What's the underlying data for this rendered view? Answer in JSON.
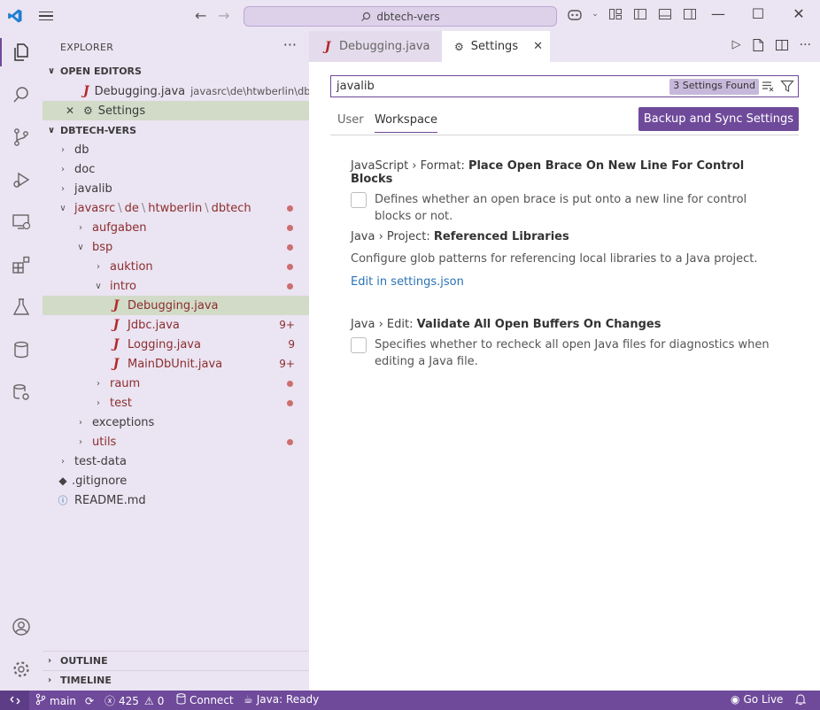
{
  "titlebar": {
    "search_text": "dbtech-vers"
  },
  "activity": {
    "items": [
      "explorer-icon",
      "search-icon",
      "source-control-icon",
      "run-debug-icon",
      "remote-explorer-icon",
      "extensions-icon",
      "testing-icon",
      "database-icon",
      "database-settings-icon",
      "account-icon",
      "manage-gear-icon"
    ]
  },
  "sidebar": {
    "title": "EXPLORER",
    "open_editors": {
      "header": "OPEN EDITORS",
      "items": [
        {
          "label": "Debugging.java",
          "desc": "javasrc\\de\\htwberlin\\dbt..."
        },
        {
          "label": "Settings"
        }
      ]
    },
    "project": {
      "header": "DBTECH-VERS",
      "tree": {
        "db": "db",
        "doc": "doc",
        "javalib": "javalib",
        "javasrc_path": [
          "javasrc",
          "de",
          "htwberlin",
          "dbtech"
        ],
        "aufgaben": "aufgaben",
        "bsp": "bsp",
        "auktion": "auktion",
        "intro": "intro",
        "files": [
          {
            "label": "Debugging.java",
            "badge": ""
          },
          {
            "label": "Jdbc.java",
            "badge": "9+"
          },
          {
            "label": "Logging.java",
            "badge": "9"
          },
          {
            "label": "MainDbUnit.java",
            "badge": "9+"
          }
        ],
        "raum": "raum",
        "test": "test",
        "exceptions": "exceptions",
        "utils": "utils",
        "test_data": "test-data",
        "gitignore": ".gitignore",
        "readme": "README.md"
      }
    },
    "outline": "OUTLINE",
    "timeline": "TIMELINE"
  },
  "tabs": [
    {
      "label": "Debugging.java"
    },
    {
      "label": "Settings"
    }
  ],
  "settings": {
    "query": "javalib",
    "found": "3 Settings Found",
    "tab_user": "User",
    "tab_workspace": "Workspace",
    "sync_button": "Backup and Sync Settings",
    "items": [
      {
        "category": "JavaScript › Format: ",
        "name": "Place Open Brace On New Line For Control Blocks",
        "desc": "Defines whether an open brace is put onto a new line for control blocks or not."
      },
      {
        "category": "Java › Project: ",
        "name": "Referenced Libraries",
        "desc": "Configure glob patterns for referencing local libraries to a Java project.",
        "link": "Edit in settings.json"
      },
      {
        "category": "Java › Edit: ",
        "name": "Validate All Open Buffers On Changes",
        "desc": "Specifies whether to recheck all open Java files for diagnostics when editing a Java file."
      }
    ]
  },
  "statusbar": {
    "branch": "main",
    "errors": "425",
    "warnings": "0",
    "connect": "Connect",
    "java": "Java: Ready",
    "golive": "Go Live"
  },
  "colors": {
    "accent": "#6f4a9a",
    "chrome": "#ebe4f2",
    "modified": "#8b2e2e"
  }
}
